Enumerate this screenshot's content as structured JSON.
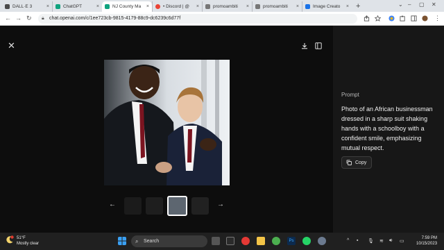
{
  "browser": {
    "tabs": [
      {
        "title": "DALL·E 3",
        "active": false,
        "color": "#4a4a4a"
      },
      {
        "title": "ChatGPT",
        "active": false,
        "color": "#10a37f"
      },
      {
        "title": "NJ County Ma",
        "active": true,
        "color": "#10a37f"
      },
      {
        "title": "• Discord | @",
        "active": false,
        "color": "#ea4335"
      },
      {
        "title": "promoambiti",
        "active": false,
        "color": "#777777"
      },
      {
        "title": "promoambiti",
        "active": false,
        "color": "#777777"
      },
      {
        "title": "Image Creato",
        "active": false,
        "color": "#1a73e8"
      }
    ],
    "new_tab": "+",
    "url": "chat.openai.com/c/1ee723cb-9815-4179-88c9-dc6239c6d77f"
  },
  "viewer": {
    "close_icon": "close-icon",
    "download_icon": "download-icon",
    "sidebar_icon": "sidebar-toggle-icon",
    "prev": "←",
    "next": "→"
  },
  "prompt": {
    "label": "Prompt",
    "text": "Photo of an African businessman dressed in a sharp suit shaking hands with a schoolboy with a confident smile, emphasizing mutual respect.",
    "copy_label": "Copy"
  },
  "taskbar": {
    "temperature": "51°F",
    "weather": "Mostly clear",
    "search_placeholder": "Search",
    "time": "7:59 PM",
    "date": "10/15/2023"
  },
  "colors": {
    "viewer_bg": "#0d0d0d",
    "panel_bg": "#171717",
    "taskbar_bg": "#202020"
  }
}
